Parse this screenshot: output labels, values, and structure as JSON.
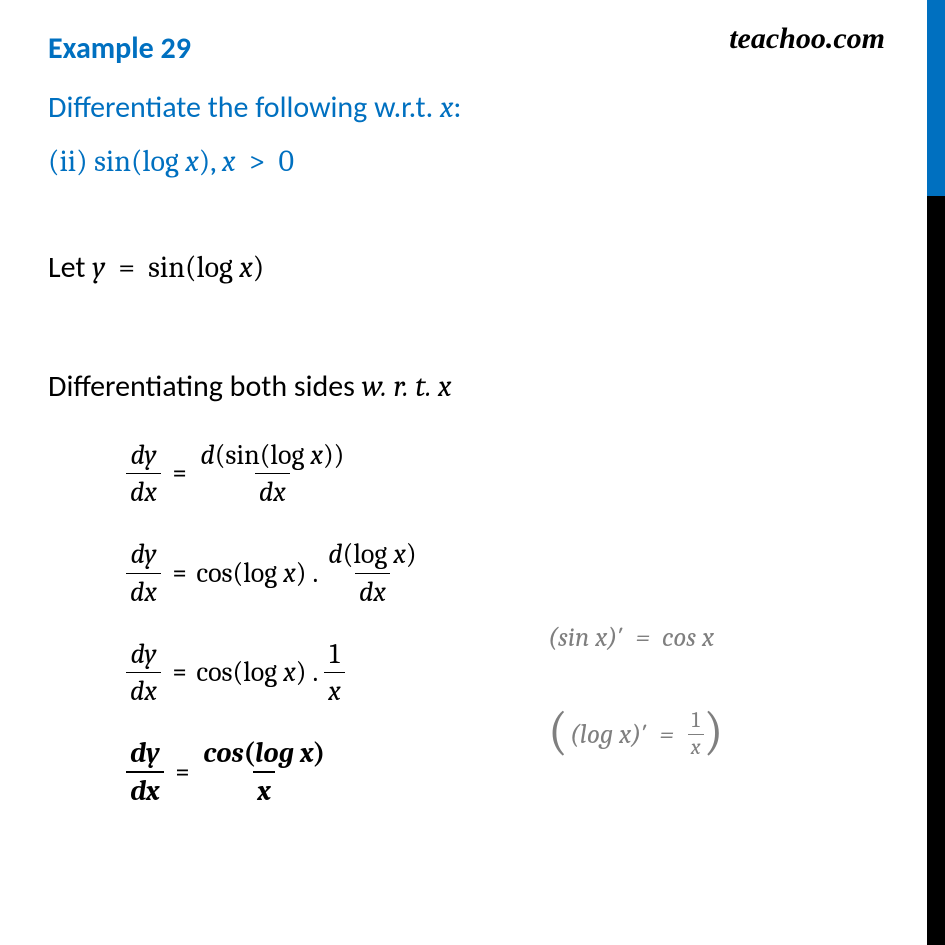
{
  "brand": "teachoo.com",
  "heading": "Example 29",
  "prompt_pre": "Differentiate the following w.r.t. ",
  "prompt_var": "x",
  "prompt_post": ":",
  "sub_label": "(ii) ",
  "sub_expr": "sin(log x), x  >  0",
  "let_pre": "Let ",
  "let_expr": "y  =  sin(log x)",
  "diff_pre": "Differentiating both sides ",
  "diff_wrt": "w. r. t. x",
  "dy": "dy",
  "dx": "dx",
  "eq": "=",
  "rhs1_num": "d(sin(log x))",
  "rhs1_den": "dx",
  "rhs2_a": "cos(log x)",
  "rhs2_dot": ".",
  "rhs2_frac_num": "d(log x)",
  "rhs2_frac_den": "dx",
  "rhs3_a": "cos(log x)",
  "rhs3_frac_num": "1",
  "rhs3_frac_den": "x",
  "rhs4_num": "cos(log x)",
  "rhs4_den": "x",
  "note1": "(sin x)′  =  cos x",
  "note2_inner": "(log x)′  = ",
  "note2_frac_num": "1",
  "note2_frac_den": "x"
}
